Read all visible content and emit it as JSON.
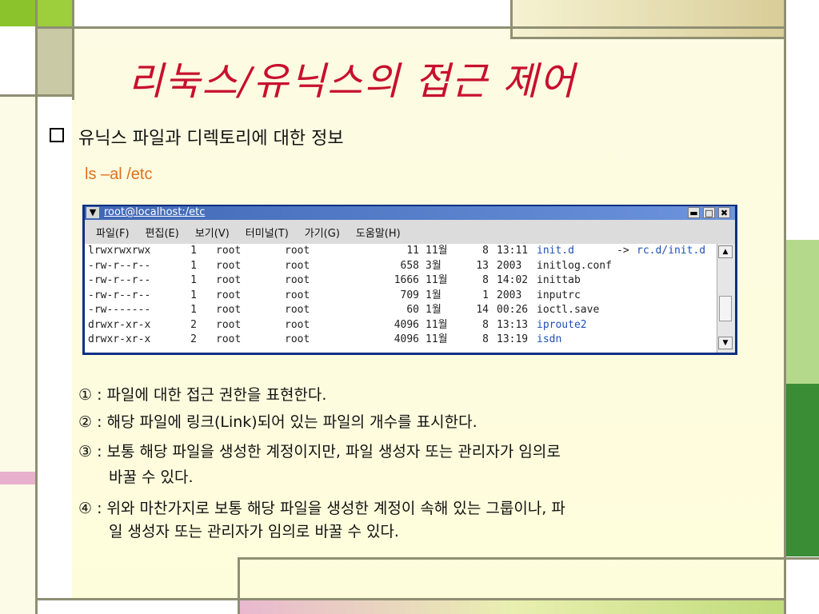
{
  "slide": {
    "title": "리눅스/유닉스의 접근 제어",
    "bullet": "유닉스 파일과 디렉토리에 대한 정보",
    "command": "ls –al /etc"
  },
  "window": {
    "title": "root@localhost:/etc",
    "buttons": [
      "▬",
      "□",
      "✖"
    ],
    "menu": [
      "파일(F)",
      "편집(E)",
      "보기(V)",
      "터미널(T)",
      "가기(G)",
      "도움말(H)"
    ]
  },
  "listing": [
    {
      "perm": "lrwxrwxrwx",
      "links": "1",
      "owner": "root",
      "group": "root",
      "size": "11",
      "month": "11월",
      "day": "8",
      "time": "13:11",
      "name": "init.d",
      "link_arrow": "->",
      "target": "rc.d/init.d"
    },
    {
      "perm": "-rw-r--r--",
      "links": "1",
      "owner": "root",
      "group": "root",
      "size": "658",
      "month": "3월",
      "day": "13",
      "time": "2003",
      "name": "initlog.conf",
      "link_arrow": "",
      "target": ""
    },
    {
      "perm": "-rw-r--r--",
      "links": "1",
      "owner": "root",
      "group": "root",
      "size": "1666",
      "month": "11월",
      "day": "8",
      "time": "14:02",
      "name": "inittab",
      "link_arrow": "",
      "target": ""
    },
    {
      "perm": "-rw-r--r--",
      "links": "1",
      "owner": "root",
      "group": "root",
      "size": "709",
      "month": "1월",
      "day": "1",
      "time": "2003",
      "name": "inputrc",
      "link_arrow": "",
      "target": ""
    },
    {
      "perm": "-rw-------",
      "links": "1",
      "owner": "root",
      "group": "root",
      "size": "60",
      "month": "1월",
      "day": "14",
      "time": "00:26",
      "name": "ioctl.save",
      "link_arrow": "",
      "target": ""
    },
    {
      "perm": "drwxr-xr-x",
      "links": "2",
      "owner": "root",
      "group": "root",
      "size": "4096",
      "month": "11월",
      "day": "8",
      "time": "13:13",
      "name": "iproute2",
      "link_arrow": "",
      "target": ""
    },
    {
      "perm": "drwxr-xr-x",
      "links": "2",
      "owner": "root",
      "group": "root",
      "size": "4096",
      "month": "11월",
      "day": "8",
      "time": "13:19",
      "name": "isdn",
      "link_arrow": "",
      "target": ""
    }
  ],
  "notes": [
    "① : 파일에 대한 접근 권한을 표현한다.",
    "② : 해당 파일에 링크(Link)되어 있는 파일의 개수를 표시한다.",
    "③ : 보통 해당 파일을 생성한 계정이지만, 파일 생성자 또는 관리자가 임의로",
    "바꿀 수 있다.",
    "④ : 위와 마찬가지로 보통 해당 파일을 생성한 계정이 속해 있는 그룹이나, 파",
    "일 생성자 또는 관리자가 임의로 바꿀 수 있다."
  ]
}
